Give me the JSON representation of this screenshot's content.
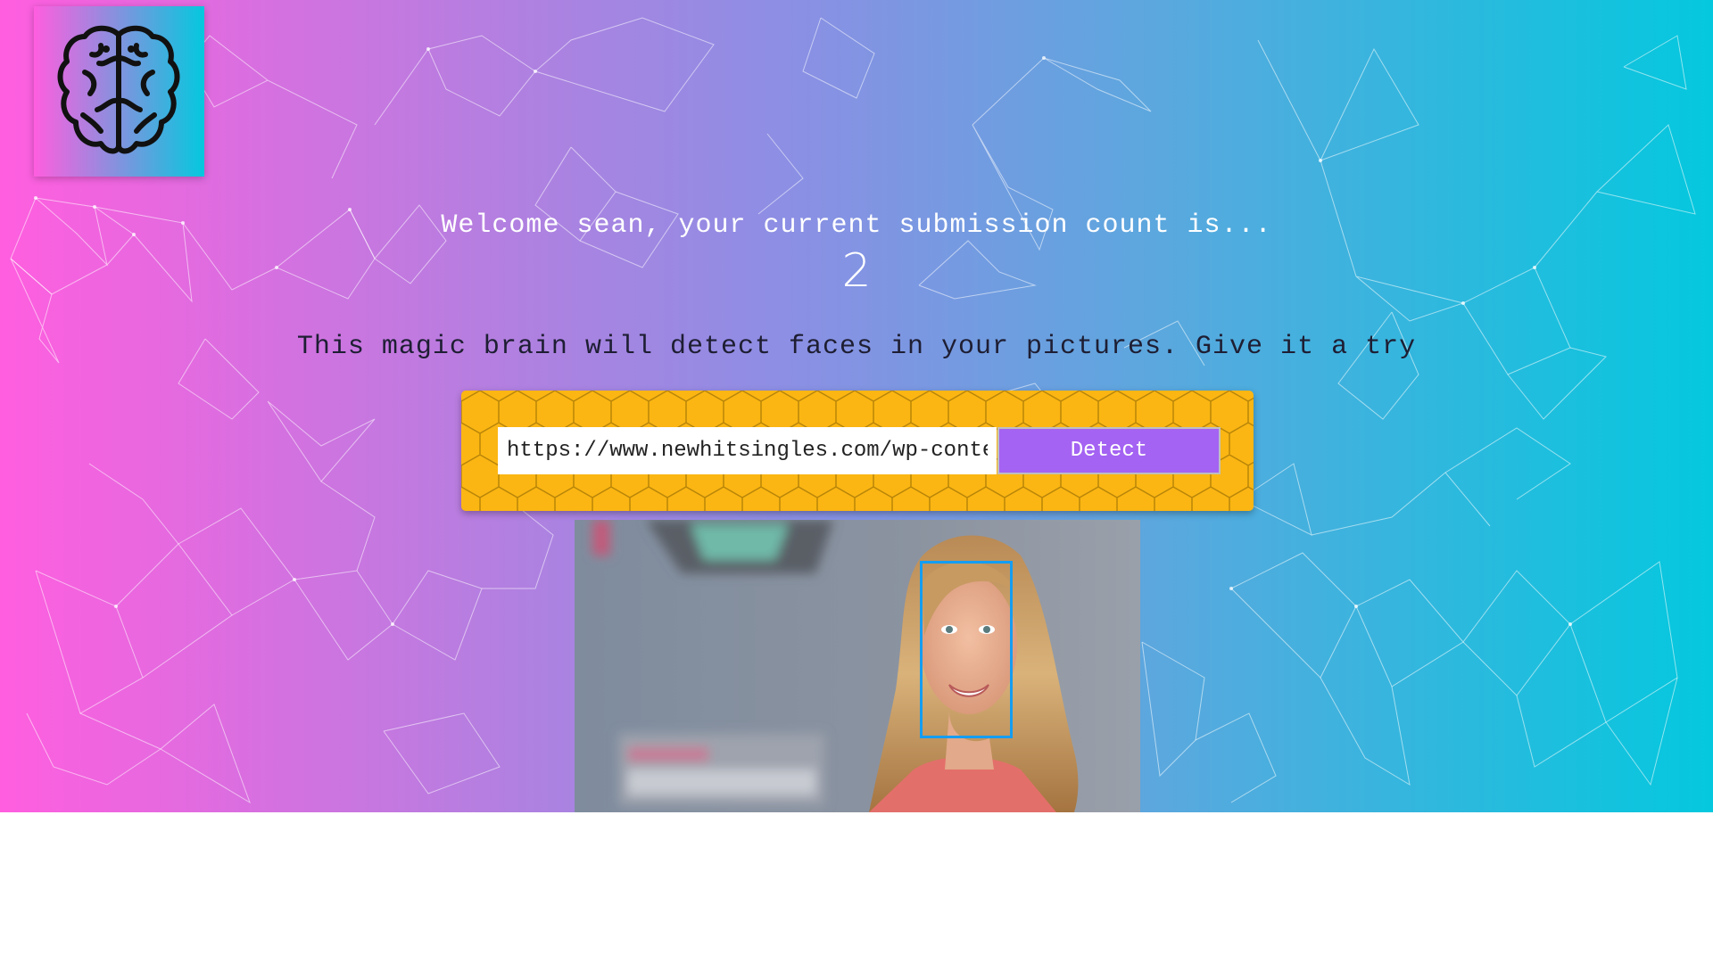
{
  "app": {
    "logo_icon": "brain-icon",
    "colors": {
      "gradient_start": "#ff5edf",
      "gradient_end": "#04c8de",
      "panel": "#fbb613",
      "button": "#a463f2",
      "face_box": "#149df2"
    }
  },
  "welcome": {
    "text": "Welcome sean, your current submission count is...",
    "count": "2"
  },
  "tagline": "This magic brain will detect faces in your pictures. Give it a try",
  "form": {
    "url_value": "https://www.newhitsingles.com/wp-content/",
    "detect_label": "Detect"
  },
  "result": {
    "faces_detected": 1
  }
}
